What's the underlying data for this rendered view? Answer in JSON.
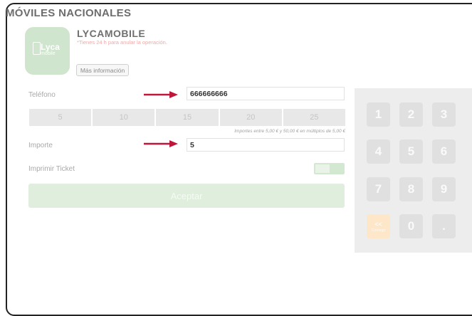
{
  "page": {
    "title": "MÓVILES NACIONALES"
  },
  "operator": {
    "logo_text": "Lyca",
    "logo_subtext": "mobile",
    "name": "LYCAMOBILE",
    "note": "*Tienes 24 h para anular la operación.",
    "info_button": "Más información"
  },
  "phone": {
    "label": "Teléfono",
    "value": "666666666"
  },
  "amounts": [
    "5",
    "10",
    "15",
    "20",
    "25"
  ],
  "amount_hint": "Importes entre 5,00 € y 50,00 € en múltiplos de 5,00 €",
  "importe": {
    "label": "Importe",
    "value": "5"
  },
  "ticket": {
    "label": "Imprimir Ticket",
    "enabled": true
  },
  "accept_button": "Aceptar",
  "keypad": {
    "keys": [
      "1",
      "2",
      "3",
      "4",
      "5",
      "6",
      "7",
      "8",
      "9"
    ],
    "correct_label": "<<",
    "correct_sub": "Corregir",
    "zero": "0",
    "dot": "."
  },
  "colors": {
    "arrow": "#c0163a",
    "accent": "#dfeedd",
    "correct": "#fde7c8"
  }
}
